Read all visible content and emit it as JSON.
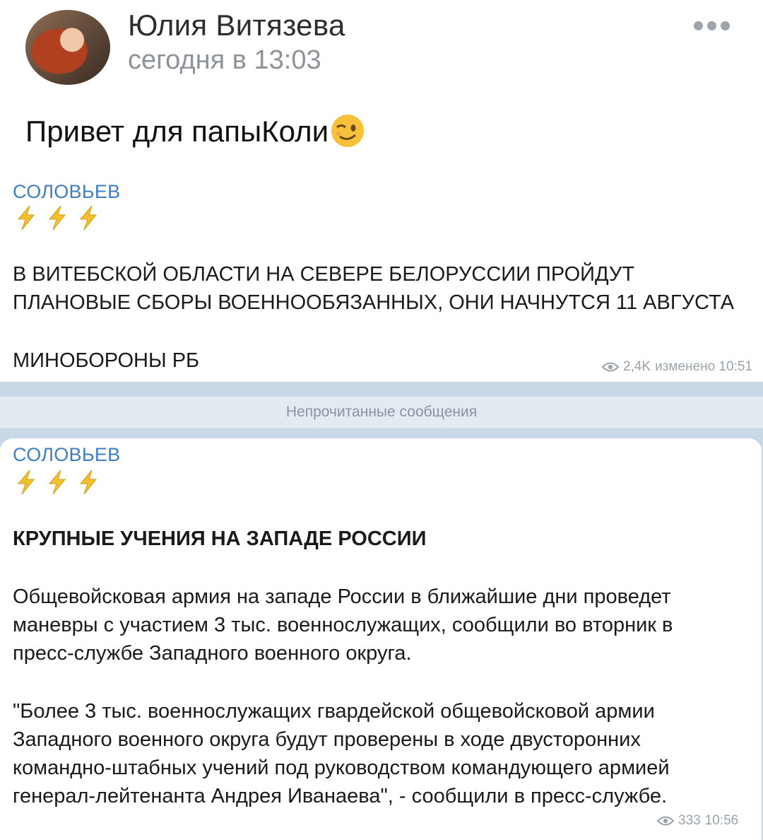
{
  "post": {
    "author": "Юлия Витязева",
    "time": "сегодня в 13:03",
    "text": "Привет для папыКоли",
    "emoji": "winking-face"
  },
  "messages": [
    {
      "channel": "СОЛОВЬЕВ",
      "lines": [
        "В ВИТЕБСКОЙ ОБЛАСТИ НА СЕВЕРЕ БЕЛОРУССИИ ПРОЙДУТ",
        "ПЛАНОВЫЕ СБОРЫ ВОЕННООБЯЗАННЫХ, ОНИ НАЧНУТСЯ 11 АВГУСТА",
        "МИНОБОРОНЫ РБ"
      ],
      "views": "2,4K",
      "edited": "изменено 10:51"
    },
    {
      "channel": "СОЛОВЬЕВ",
      "heading": "КРУПНЫЕ УЧЕНИЯ НА ЗАПАДЕ РОССИИ",
      "para1": [
        "Общевойсковая армия на западе России в ближайшие дни проведет",
        "маневры с участием 3 тыс. военнослужащих, сообщили во вторник в",
        "пресс-службе Западного военного округа."
      ],
      "para2": [
        "\"Более 3 тыс. военнослужащих гвардейской общевойсковой армии",
        "Западного военного округа будут проверены в ходе двусторонних",
        "командно-штабных учений под руководством командующего армией",
        "генерал-лейтенанта Андрея Иванаева\", - сообщили в пресс-службе."
      ],
      "views": "333",
      "time": "10:56"
    }
  ],
  "divider": "Непрочитанные сообщения",
  "colors": {
    "channel": "#3f7ec2",
    "bolt": "#f2c12e",
    "chat_bg": "#c9d8e6"
  }
}
